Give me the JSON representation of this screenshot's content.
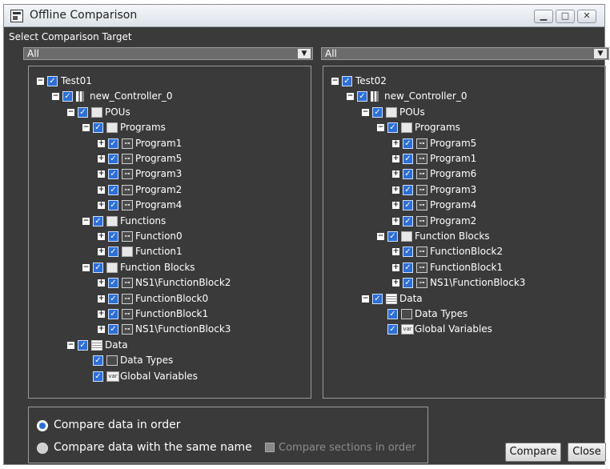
{
  "window": {
    "title": "Offline Comparison"
  },
  "section": {
    "title": "Select Comparison Target"
  },
  "left_dropdown": {
    "value": "All"
  },
  "right_dropdown": {
    "value": "All"
  },
  "left_tree": [
    {
      "depth": 0,
      "exp": "minus",
      "icon": "",
      "label": "Test01"
    },
    {
      "depth": 1,
      "exp": "minus",
      "icon": "controller",
      "label": "new_Controller_0"
    },
    {
      "depth": 2,
      "exp": "minus",
      "icon": "folder",
      "label": "POUs"
    },
    {
      "depth": 3,
      "exp": "minus",
      "icon": "folder",
      "label": "Programs"
    },
    {
      "depth": 4,
      "exp": "plus",
      "icon": "program",
      "label": "Program1"
    },
    {
      "depth": 4,
      "exp": "plus",
      "icon": "program",
      "label": "Program5"
    },
    {
      "depth": 4,
      "exp": "plus",
      "icon": "program",
      "label": "Program3"
    },
    {
      "depth": 4,
      "exp": "plus",
      "icon": "program",
      "label": "Program2"
    },
    {
      "depth": 4,
      "exp": "plus",
      "icon": "program",
      "label": "Program4"
    },
    {
      "depth": 3,
      "exp": "minus",
      "icon": "folder",
      "label": "Functions"
    },
    {
      "depth": 4,
      "exp": "plus",
      "icon": "program",
      "label": "Function0"
    },
    {
      "depth": 4,
      "exp": "plus",
      "icon": "function",
      "label": "Function1"
    },
    {
      "depth": 3,
      "exp": "minus",
      "icon": "folder",
      "label": "Function Blocks"
    },
    {
      "depth": 4,
      "exp": "plus",
      "icon": "program",
      "label": "NS1\\FunctionBlock2"
    },
    {
      "depth": 4,
      "exp": "plus",
      "icon": "program",
      "label": "FunctionBlock0"
    },
    {
      "depth": 4,
      "exp": "plus",
      "icon": "program",
      "label": "FunctionBlock1"
    },
    {
      "depth": 4,
      "exp": "plus",
      "icon": "program",
      "label": "NS1\\FunctionBlock3"
    },
    {
      "depth": 2,
      "exp": "minus",
      "icon": "data",
      "label": "Data"
    },
    {
      "depth": 3,
      "exp": "",
      "icon": "datatypes",
      "label": "Data Types"
    },
    {
      "depth": 3,
      "exp": "",
      "icon": "var",
      "label": "Global Variables"
    }
  ],
  "right_tree": [
    {
      "depth": 0,
      "exp": "minus",
      "icon": "",
      "label": "Test02"
    },
    {
      "depth": 1,
      "exp": "minus",
      "icon": "controller",
      "label": "new_Controller_0"
    },
    {
      "depth": 2,
      "exp": "minus",
      "icon": "folder",
      "label": "POUs"
    },
    {
      "depth": 3,
      "exp": "minus",
      "icon": "folder",
      "label": "Programs"
    },
    {
      "depth": 4,
      "exp": "plus",
      "icon": "program",
      "label": "Program5"
    },
    {
      "depth": 4,
      "exp": "plus",
      "icon": "program",
      "label": "Program1"
    },
    {
      "depth": 4,
      "exp": "plus",
      "icon": "program",
      "label": "Program6"
    },
    {
      "depth": 4,
      "exp": "plus",
      "icon": "program",
      "label": "Program3"
    },
    {
      "depth": 4,
      "exp": "plus",
      "icon": "program",
      "label": "Program4"
    },
    {
      "depth": 4,
      "exp": "plus",
      "icon": "program",
      "label": "Program2"
    },
    {
      "depth": 3,
      "exp": "minus",
      "icon": "folder",
      "label": "Function Blocks"
    },
    {
      "depth": 4,
      "exp": "plus",
      "icon": "program",
      "label": "FunctionBlock2"
    },
    {
      "depth": 4,
      "exp": "plus",
      "icon": "program",
      "label": "FunctionBlock1"
    },
    {
      "depth": 4,
      "exp": "plus",
      "icon": "program",
      "label": "NS1\\FunctionBlock3"
    },
    {
      "depth": 2,
      "exp": "minus",
      "icon": "data",
      "label": "Data"
    },
    {
      "depth": 3,
      "exp": "",
      "icon": "datatypes",
      "label": "Data Types"
    },
    {
      "depth": 3,
      "exp": "",
      "icon": "var",
      "label": "Global Variables"
    }
  ],
  "options": {
    "in_order": "Compare data in order",
    "same_name": "Compare data with the same name",
    "sections_in_order": "Compare sections in order"
  },
  "buttons": {
    "compare": "Compare",
    "close": "Close"
  },
  "icon_text": {
    "var": "var",
    "program": "⊶"
  },
  "colors": {
    "background": "#3a3a3a",
    "checkbox": "#2d6fd6",
    "text": "#ffffff"
  }
}
